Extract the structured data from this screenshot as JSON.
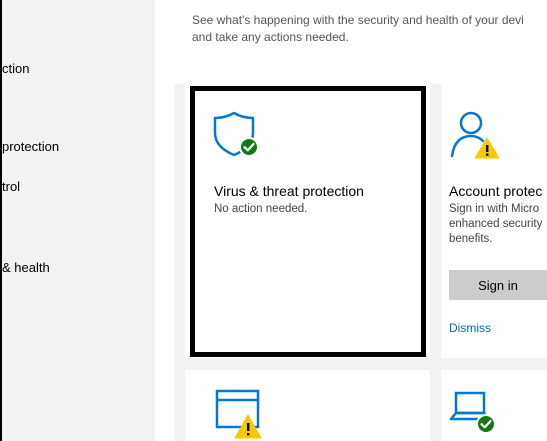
{
  "sidebar": {
    "items": [
      {
        "label": "ction"
      },
      {
        "label": "protection"
      },
      {
        "label": "trol"
      },
      {
        "label": "& health"
      }
    ]
  },
  "main": {
    "intro_line1": "See what's happening with the security and health of your devi",
    "intro_line2": "and take any actions needed."
  },
  "cards": {
    "virus": {
      "title": "Virus & threat protection",
      "status": "No action needed.",
      "icon": "shield-check-icon"
    },
    "account": {
      "title": "Account protec",
      "desc_line1": "Sign in with Micro",
      "desc_line2": "enhanced security",
      "desc_line3": "benefits.",
      "button": "Sign in",
      "link": "Dismiss",
      "icon": "person-warning-icon"
    },
    "app_browser": {
      "icon": "browser-warning-icon"
    },
    "device": {
      "icon": "laptop-check-icon"
    }
  },
  "colors": {
    "accent": "#0067b8",
    "icon_blue": "#0078d4",
    "ok_green": "#107c10",
    "warn_yellow": "#f8c800"
  }
}
